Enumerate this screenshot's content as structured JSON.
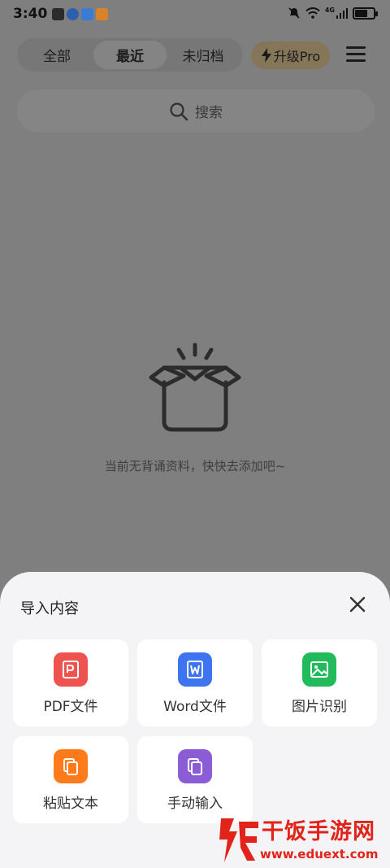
{
  "status": {
    "time": "3:40",
    "network": "4G"
  },
  "tabs": [
    {
      "label": "全部",
      "active": false
    },
    {
      "label": "最近",
      "active": true
    },
    {
      "label": "未归档",
      "active": false
    }
  ],
  "upgrade": {
    "label": "升级Pro"
  },
  "search": {
    "placeholder": "搜索"
  },
  "empty": {
    "message": "当前无背诵资料，快快去添加吧~"
  },
  "sheet": {
    "title": "导入内容",
    "items": [
      {
        "label": "PDF文件",
        "icon": "pdf-icon",
        "color": "#ef5350"
      },
      {
        "label": "Word文件",
        "icon": "word-icon",
        "color": "#3f74f1"
      },
      {
        "label": "图片识别",
        "icon": "image-icon",
        "color": "#22bb5b"
      },
      {
        "label": "粘贴文本",
        "icon": "paste-icon",
        "color": "#ff7a1a"
      },
      {
        "label": "手动输入",
        "icon": "manual-input-icon",
        "color": "#8b5cd6"
      }
    ]
  },
  "watermark": {
    "title": "干饭手游网",
    "url": "www.eduext.com"
  }
}
